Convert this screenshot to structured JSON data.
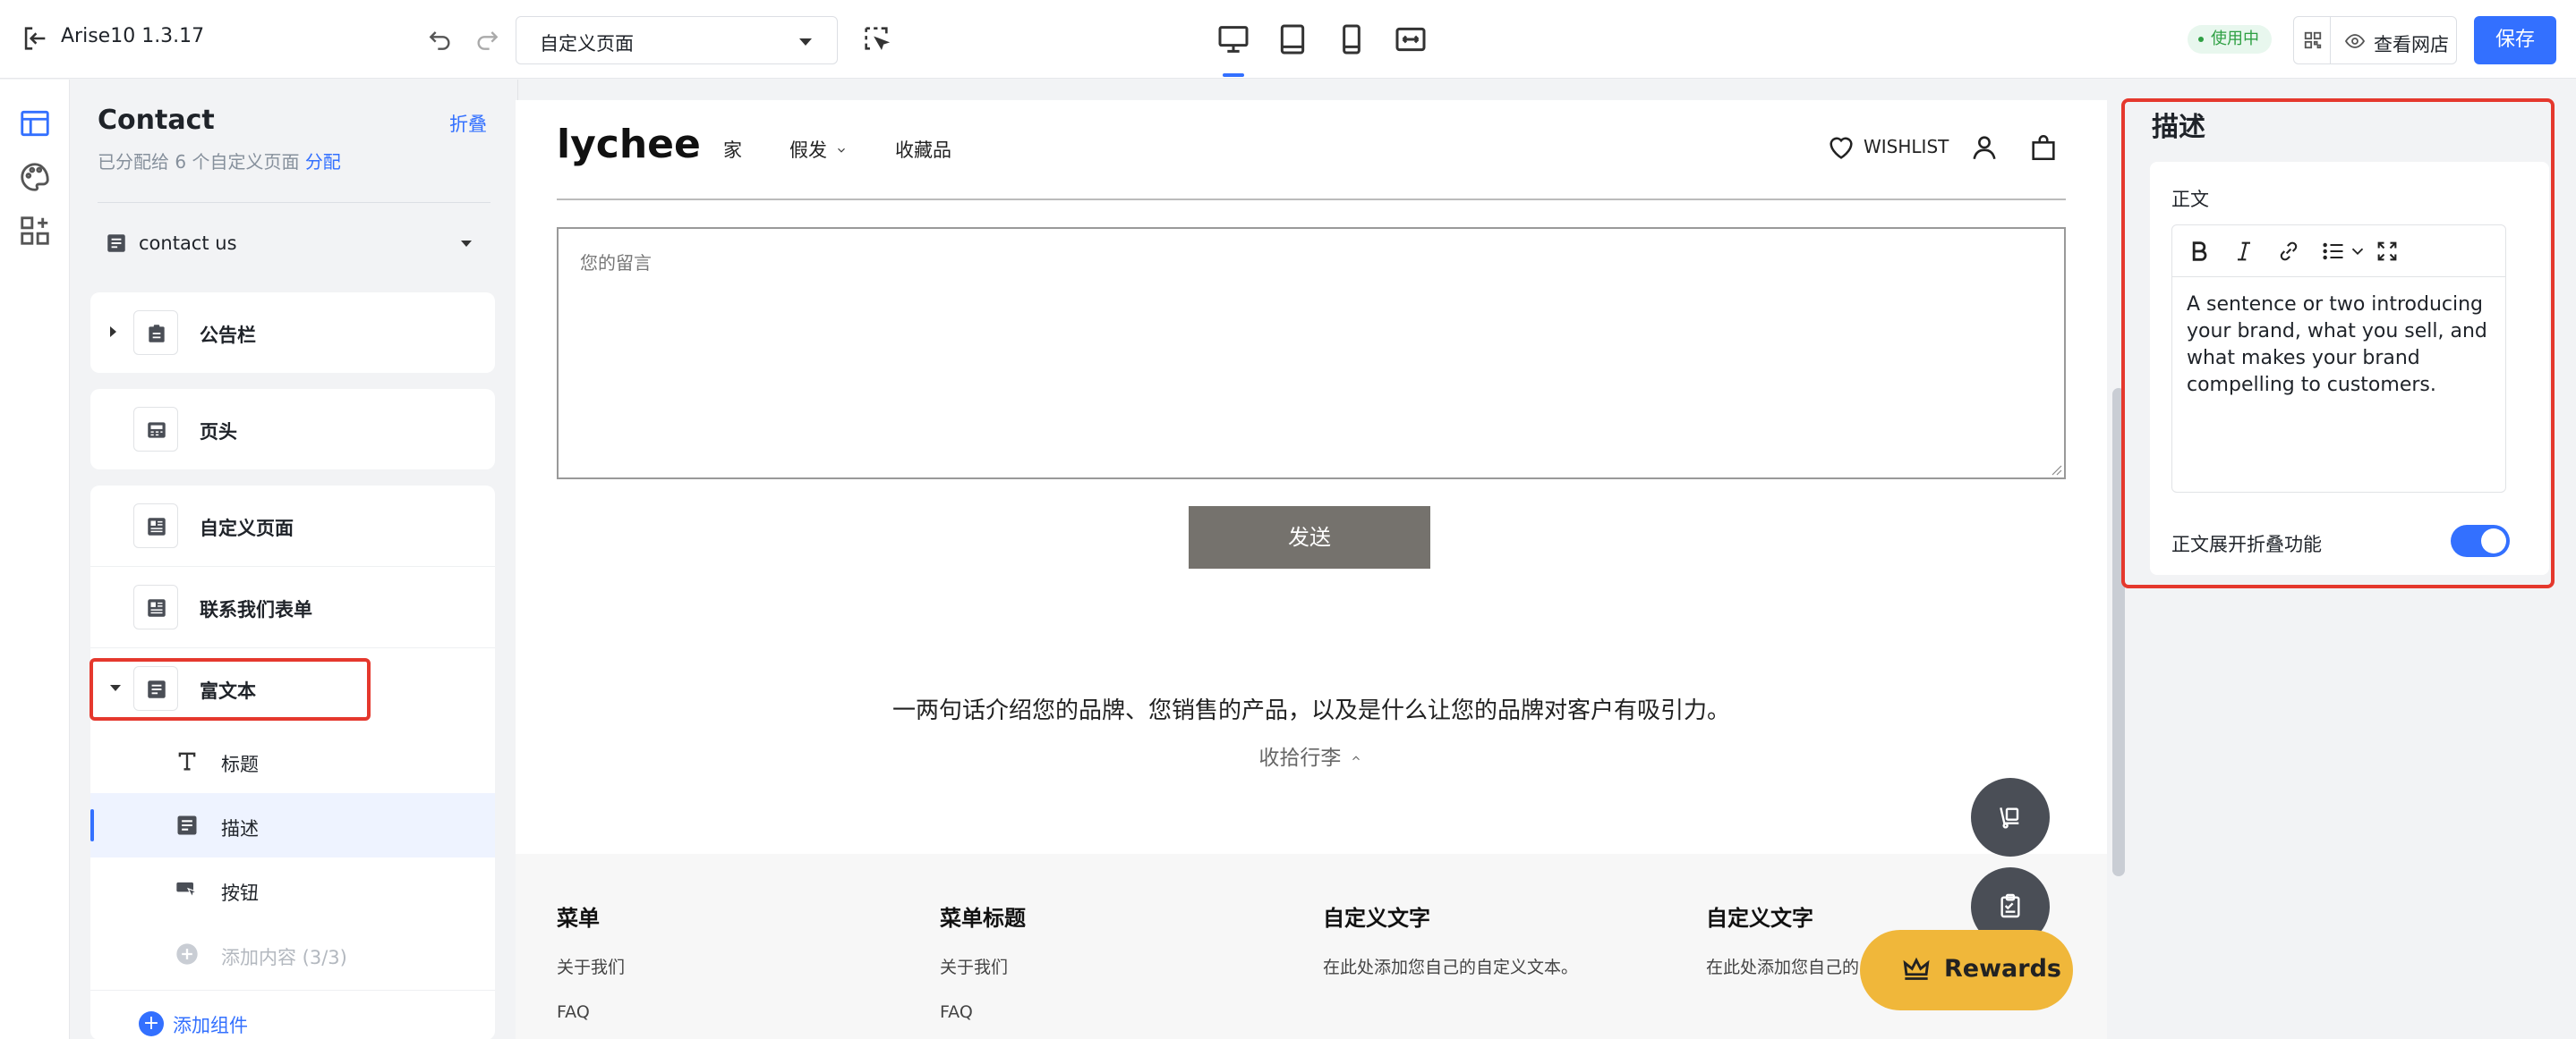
{
  "app": {
    "name": "Arise10 1.3.17"
  },
  "topbar": {
    "page_select": "自定义页面",
    "status_badge": "使用中",
    "view_store": "查看网店",
    "save": "保存"
  },
  "left_panel": {
    "title": "Contact",
    "fold": "折叠",
    "subtitle_prefix": "已分配给 6 个自定义页面",
    "subtitle_link": "分配",
    "template_select": "contact us",
    "sections": [
      {
        "label": "公告栏"
      },
      {
        "label": "页头"
      },
      {
        "label": "自定义页面"
      },
      {
        "label": "联系我们表单"
      },
      {
        "label": "富文本"
      }
    ],
    "blocks": [
      {
        "label": "标题"
      },
      {
        "label": "描述"
      },
      {
        "label": "按钮"
      }
    ],
    "add_content": "添加内容 (3/3)",
    "add_component": "添加组件"
  },
  "canvas": {
    "logo": "lychee",
    "nav": [
      "家",
      "假发",
      "收藏品"
    ],
    "wishlist": "WISHLIST",
    "message_placeholder": "您的留言",
    "send": "发送",
    "richtext": "一两句话介绍您的品牌、您销售的产品，以及是什么让您的品牌对客户有吸引力。",
    "collapse": "收拾行李",
    "footer": [
      {
        "heading": "菜单",
        "links": [
          "关于我们",
          "FAQ"
        ]
      },
      {
        "heading": "菜单标题",
        "links": [
          "关于我们",
          "FAQ"
        ]
      },
      {
        "heading": "自定义文字",
        "links": [
          "在此处添加您自己的自定义文本。"
        ]
      },
      {
        "heading": "自定义文字",
        "links": [
          "在此处添加您自己的"
        ]
      }
    ],
    "rewards": "Rewards"
  },
  "right_panel": {
    "title": "描述",
    "field_label": "正文",
    "content": "A sentence or two introducing your brand, what you sell, and what makes your brand compelling to customers.",
    "toggle_label": "正文展开折叠功能",
    "toggle_on": true
  },
  "colors": {
    "accent": "#3370ff",
    "highlight": "#e5382d",
    "send_button": "#75726d",
    "rewards": "#f0b73a"
  }
}
